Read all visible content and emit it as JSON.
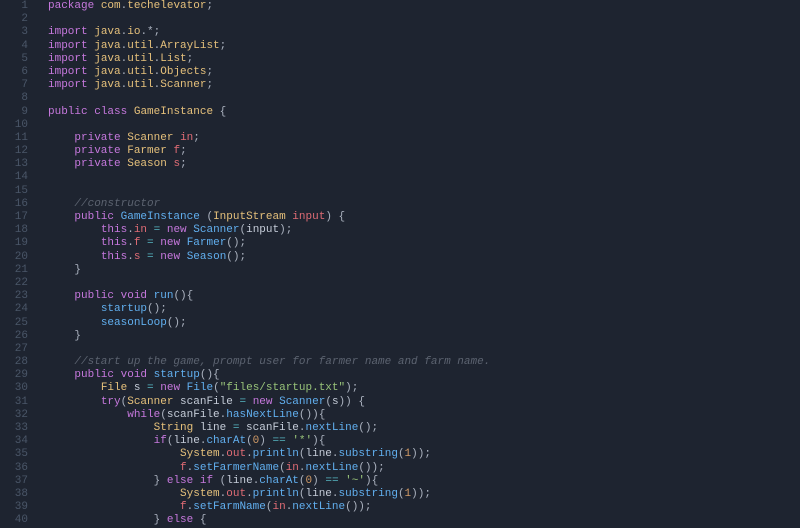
{
  "lines": [
    {
      "n": 1,
      "html": "<span class='kw'>package</span> <span class='pkg'>com</span><span class='punct'>.</span><span class='pkg'>techelevator</span><span class='punct'>;</span>"
    },
    {
      "n": 2,
      "html": ""
    },
    {
      "n": 3,
      "html": "<span class='kw'>import</span> <span class='pkg'>java</span><span class='punct'>.</span><span class='pkg'>io</span><span class='punct'>.*;</span>"
    },
    {
      "n": 4,
      "html": "<span class='kw'>import</span> <span class='pkg'>java</span><span class='punct'>.</span><span class='pkg'>util</span><span class='punct'>.</span><span class='pkg'>ArrayList</span><span class='punct'>;</span>"
    },
    {
      "n": 5,
      "html": "<span class='kw'>import</span> <span class='pkg'>java</span><span class='punct'>.</span><span class='pkg'>util</span><span class='punct'>.</span><span class='pkg'>List</span><span class='punct'>;</span>"
    },
    {
      "n": 6,
      "html": "<span class='kw'>import</span> <span class='pkg'>java</span><span class='punct'>.</span><span class='pkg'>util</span><span class='punct'>.</span><span class='pkg'>Objects</span><span class='punct'>;</span>"
    },
    {
      "n": 7,
      "html": "<span class='kw'>import</span> <span class='pkg'>java</span><span class='punct'>.</span><span class='pkg'>util</span><span class='punct'>.</span><span class='pkg'>Scanner</span><span class='punct'>;</span>"
    },
    {
      "n": 8,
      "html": ""
    },
    {
      "n": 9,
      "html": "<span class='kw'>public</span> <span class='kw'>class</span> <span class='type'>GameInstance</span> <span class='punct'>{</span>"
    },
    {
      "n": 10,
      "html": ""
    },
    {
      "n": 11,
      "html": "    <span class='kw'>private</span> <span class='type'>Scanner</span> <span class='ident'>in</span><span class='punct'>;</span>"
    },
    {
      "n": 12,
      "html": "    <span class='kw'>private</span> <span class='type'>Farmer</span> <span class='ident'>f</span><span class='punct'>;</span>"
    },
    {
      "n": 13,
      "html": "    <span class='kw'>private</span> <span class='type'>Season</span> <span class='ident'>s</span><span class='punct'>;</span>"
    },
    {
      "n": 14,
      "html": ""
    },
    {
      "n": 15,
      "html": ""
    },
    {
      "n": 16,
      "html": "    <span class='comment'>//constructor</span>"
    },
    {
      "n": 17,
      "html": "    <span class='kw'>public</span> <span class='ctor'>GameInstance</span> <span class='punct'>(</span><span class='type'>InputStream</span> <span class='param'>input</span><span class='punct'>) {</span>"
    },
    {
      "n": 18,
      "html": "        <span class='kw'>this</span><span class='punct'>.</span><span class='ident'>in</span> <span class='op'>=</span> <span class='kw'>new</span> <span class='ctor'>Scanner</span><span class='punct'>(</span>input<span class='punct'>);</span>"
    },
    {
      "n": 19,
      "html": "        <span class='kw'>this</span><span class='punct'>.</span><span class='ident'>f</span> <span class='op'>=</span> <span class='kw'>new</span> <span class='ctor'>Farmer</span><span class='punct'>();</span>"
    },
    {
      "n": 20,
      "html": "        <span class='kw'>this</span><span class='punct'>.</span><span class='ident'>s</span> <span class='op'>=</span> <span class='kw'>new</span> <span class='ctor'>Season</span><span class='punct'>();</span>"
    },
    {
      "n": 21,
      "html": "    <span class='punct'>}</span>"
    },
    {
      "n": 22,
      "html": ""
    },
    {
      "n": 23,
      "html": "    <span class='kw'>public</span> <span class='kw'>void</span> <span class='fn'>run</span><span class='punct'>(){</span>"
    },
    {
      "n": 24,
      "html": "        <span class='fn'>startup</span><span class='punct'>();</span>"
    },
    {
      "n": 25,
      "html": "        <span class='fn'>seasonLoop</span><span class='punct'>();</span>"
    },
    {
      "n": 26,
      "html": "    <span class='punct'>}</span>"
    },
    {
      "n": 27,
      "html": ""
    },
    {
      "n": 28,
      "html": "    <span class='comment'>//start up the game, prompt user for farmer name and farm name.</span>"
    },
    {
      "n": 29,
      "html": "    <span class='kw'>public</span> <span class='kw'>void</span> <span class='fn'>startup</span><span class='punct'>(){</span>"
    },
    {
      "n": 30,
      "html": "        <span class='type'>File</span> s <span class='op'>=</span> <span class='kw'>new</span> <span class='ctor'>File</span><span class='punct'>(</span><span class='str'>\"files/startup.txt\"</span><span class='punct'>);</span>"
    },
    {
      "n": 31,
      "html": "        <span class='kw'>try</span><span class='punct'>(</span><span class='type'>Scanner</span> scanFile <span class='op'>=</span> <span class='kw'>new</span> <span class='ctor'>Scanner</span><span class='punct'>(</span>s<span class='punct'>)) {</span>"
    },
    {
      "n": 32,
      "html": "            <span class='kw'>while</span><span class='punct'>(</span>scanFile<span class='punct'>.</span><span class='fn'>hasNextLine</span><span class='punct'>()){</span>"
    },
    {
      "n": 33,
      "html": "                <span class='type'>String</span> line <span class='op'>=</span> scanFile<span class='punct'>.</span><span class='fn'>nextLine</span><span class='punct'>();</span>"
    },
    {
      "n": 34,
      "html": "                <span class='kw'>if</span><span class='punct'>(</span>line<span class='punct'>.</span><span class='fn'>charAt</span><span class='punct'>(</span><span class='num'>0</span><span class='punct'>)</span> <span class='op'>==</span> <span class='char'>'*'</span><span class='punct'>){</span>"
    },
    {
      "n": 35,
      "html": "                    <span class='type'>System</span><span class='punct'>.</span><span class='ident'>out</span><span class='punct'>.</span><span class='fn'>println</span><span class='punct'>(</span>line<span class='punct'>.</span><span class='fn'>substring</span><span class='punct'>(</span><span class='num'>1</span><span class='punct'>));</span>"
    },
    {
      "n": 36,
      "html": "                    <span class='ident'>f</span><span class='punct'>.</span><span class='fn'>setFarmerName</span><span class='punct'>(</span><span class='ident'>in</span><span class='punct'>.</span><span class='fn'>nextLine</span><span class='punct'>());</span>"
    },
    {
      "n": 37,
      "html": "                <span class='punct'>}</span> <span class='kw'>else</span> <span class='kw'>if</span> <span class='punct'>(</span>line<span class='punct'>.</span><span class='fn'>charAt</span><span class='punct'>(</span><span class='num'>0</span><span class='punct'>)</span> <span class='op'>==</span> <span class='char'>'~'</span><span class='punct'>){</span>"
    },
    {
      "n": 38,
      "html": "                    <span class='type'>System</span><span class='punct'>.</span><span class='ident'>out</span><span class='punct'>.</span><span class='fn'>println</span><span class='punct'>(</span>line<span class='punct'>.</span><span class='fn'>substring</span><span class='punct'>(</span><span class='num'>1</span><span class='punct'>));</span>"
    },
    {
      "n": 39,
      "html": "                    <span class='ident'>f</span><span class='punct'>.</span><span class='fn'>setFarmName</span><span class='punct'>(</span><span class='ident'>in</span><span class='punct'>.</span><span class='fn'>nextLine</span><span class='punct'>());</span>"
    },
    {
      "n": 40,
      "html": "                <span class='punct'>}</span> <span class='kw'>else</span> <span class='punct'>{</span>"
    }
  ]
}
